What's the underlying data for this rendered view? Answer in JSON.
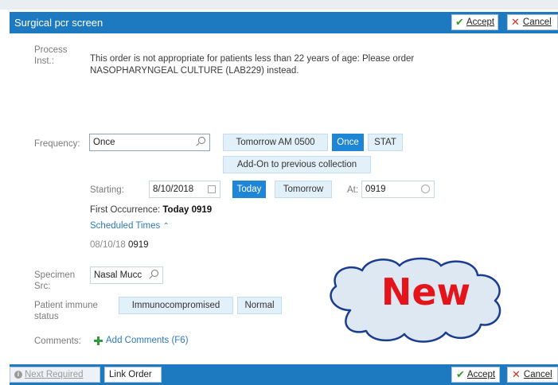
{
  "dialog": {
    "title": "Surgical pcr screen",
    "accept_label": "Accept",
    "cancel_label": "Cancel"
  },
  "process_inst": {
    "label_line1": "Process",
    "label_line2": "Inst.:",
    "text_line1": "This order is not appropriate for patients less than 22 years of age: Please order",
    "text_line2": "NASOPHARYNGEAL CULTURE (LAB229) instead."
  },
  "frequency": {
    "label": "Frequency:",
    "value": "Once",
    "options": [
      "Tomorrow AM 0500",
      "Once",
      "STAT",
      "Add-On to previous collection"
    ],
    "selected": "Once"
  },
  "starting": {
    "label": "Starting:",
    "date": "8/10/2018",
    "today_label": "Today",
    "tomorrow_label": "Tomorrow",
    "at_label": "At:",
    "time": "0919"
  },
  "first_occurrence": {
    "label": "First Occurrence:",
    "value": "Today 0919"
  },
  "scheduled_times": {
    "label": "Scheduled Times",
    "chevron": "^",
    "date": "08/10/18",
    "time": "0919"
  },
  "specimen": {
    "label_line1": "Specimen",
    "label_line2": "Src:",
    "value": "Nasal Mucc"
  },
  "immune": {
    "label_line1": "Patient immune",
    "label_line2": "status",
    "options": [
      "Immunocompromised",
      "Normal"
    ]
  },
  "comments": {
    "label": "Comments:",
    "add_label": "Add Comments (F6)"
  },
  "footer": {
    "next_required_label": "Next Required",
    "link_order_label": "Link Order",
    "accept_label": "Accept",
    "cancel_label": "Cancel"
  },
  "callout": {
    "text": "New"
  },
  "colors": {
    "header_blue": "#1e7ac0",
    "chip_bg": "#e2f0f9",
    "chip_selected": "#1f86d6",
    "callout_text": "#e4141b",
    "cloud_fill": "#dde8f3"
  }
}
